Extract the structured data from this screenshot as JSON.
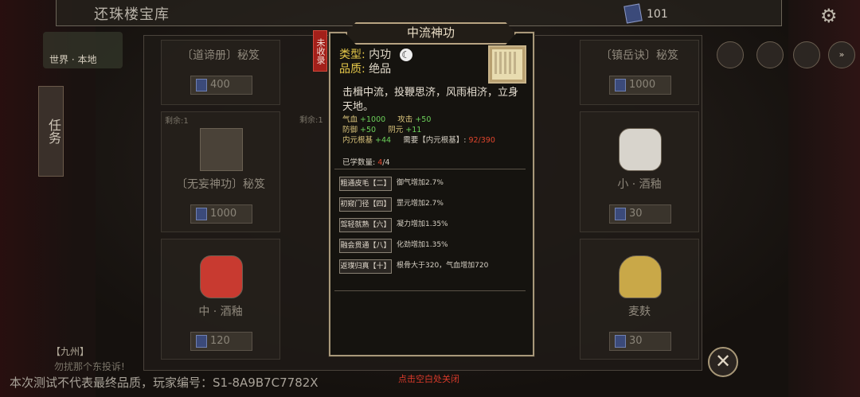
{
  "header": {
    "minimap_label": "世界 · 本地",
    "shop_title": "还珠楼宝库",
    "currency_value": "101"
  },
  "left_tab": {
    "label": "任务"
  },
  "grid": {
    "items": [
      {
        "name": "〔道谛册〕秘笈",
        "price": "400",
        "remain": ""
      },
      {
        "name": "〔镇岳诀〕秘笈",
        "price": "1000",
        "remain": ""
      },
      {
        "name": "〔无妄神功〕秘笈",
        "price": "1000",
        "remain": "剩余:1"
      },
      {
        "name": "小 · 酒釉",
        "price": "30",
        "remain": ""
      },
      {
        "name": "中 · 酒釉",
        "price": "120",
        "remain": ""
      },
      {
        "name": "麦麸",
        "price": "30",
        "remain": ""
      }
    ],
    "remain_2": "剩余:1"
  },
  "dialog": {
    "title": "中流神功",
    "badge": "未收录",
    "type_label": "类型:",
    "type_value": "内功",
    "quality_label": "品质:",
    "quality_value": "绝品",
    "description": "击楫中流，投鞭思济，风雨相济，立身天地。",
    "stats": [
      {
        "label": "气血",
        "value": "+1000"
      },
      {
        "label": "攻击",
        "value": "+50"
      },
      {
        "label": "防御",
        "value": "+50"
      },
      {
        "label": "阴元",
        "value": "+11"
      },
      {
        "label": "内元根基",
        "value": "+44"
      }
    ],
    "requirement": {
      "prefix": "需要【内元根基】:",
      "current": "92",
      "sep": "/",
      "total": "390"
    },
    "learned": {
      "label": "已学数量:",
      "current": "4",
      "sep": "/",
      "total": "4"
    },
    "skills": [
      {
        "name": "粗通皮毛【二】",
        "effect": "御气增加2.7%"
      },
      {
        "name": "初窥门径【四】",
        "effect": "罡元增加2.7%"
      },
      {
        "name": "驾轻就熟【六】",
        "effect": "凝力增加1.35%"
      },
      {
        "name": "融会贯通【八】",
        "effect": "化劲增加1.35%"
      },
      {
        "name": "返璞归真【十】",
        "effect": "根骨大于320，气血增加720"
      }
    ]
  },
  "chat": {
    "line1": "【九州】",
    "line2": "勿扰那个东投诉!"
  },
  "footer": {
    "notice": "本次测试不代表最终品质，玩家编号：S1-8A9B7C7782X",
    "close_hint": "点击空白处关闭"
  }
}
